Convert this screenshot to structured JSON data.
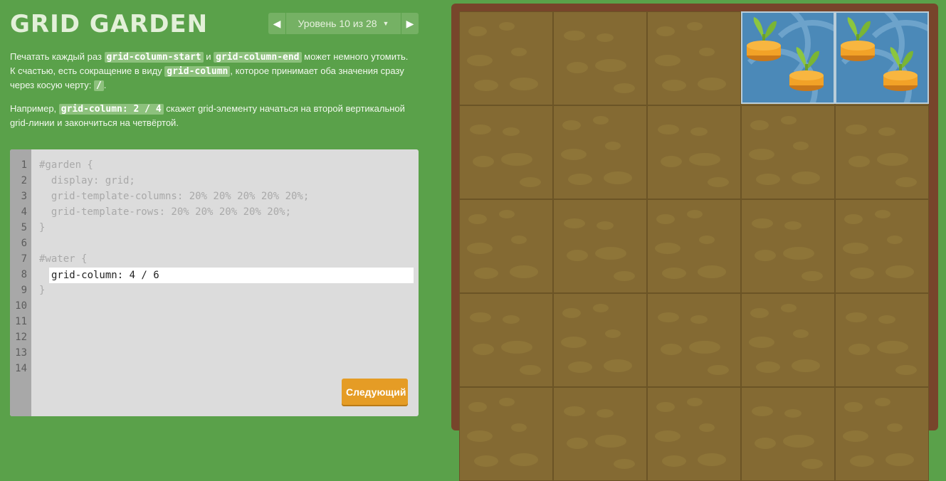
{
  "header": {
    "title": "GRID GARDEN",
    "level_label": "Уровень 10 из 28",
    "prev_icon": "triangle-left-icon",
    "next_icon": "triangle-right-icon"
  },
  "instructions": {
    "p1_a": "Печатать каждый раз ",
    "p1_code1": "grid-column-start",
    "p1_b": " и ",
    "p1_code2": "grid-column-end",
    "p1_c": " может немного утомить. К счастью, есть сокращение в виду ",
    "p1_code3": "grid-column",
    "p1_d": ", которое принимает оба значения сразу через косую черту: ",
    "p1_code4": "/",
    "p1_e": ".",
    "p2_a": "Например, ",
    "p2_code": "grid-column: 2 / 4",
    "p2_b": " скажет grid-элементу начаться на второй вертикальной grid-линии и закончиться на четвёртой."
  },
  "editor": {
    "line_numbers": [
      "1",
      "2",
      "3",
      "4",
      "5",
      "6",
      "7",
      "8",
      "9",
      "10",
      "11",
      "12",
      "13",
      "14"
    ],
    "code_lines": [
      "#garden {",
      "  display: grid;",
      "  grid-template-columns: 20% 20% 20% 20% 20%;",
      "  grid-template-rows: 20% 20% 20% 20% 20%;",
      "}",
      "",
      "#water {",
      "",
      "}",
      "",
      "",
      "",
      "",
      ""
    ],
    "input_value": "grid-column: 4 / 6",
    "next_button": "Следующий"
  },
  "garden": {
    "columns": 5,
    "rows": 5,
    "soil_color": "#846a33",
    "water_color": "#4b89b8",
    "water_column_start": 4,
    "water_column_end": 6
  }
}
